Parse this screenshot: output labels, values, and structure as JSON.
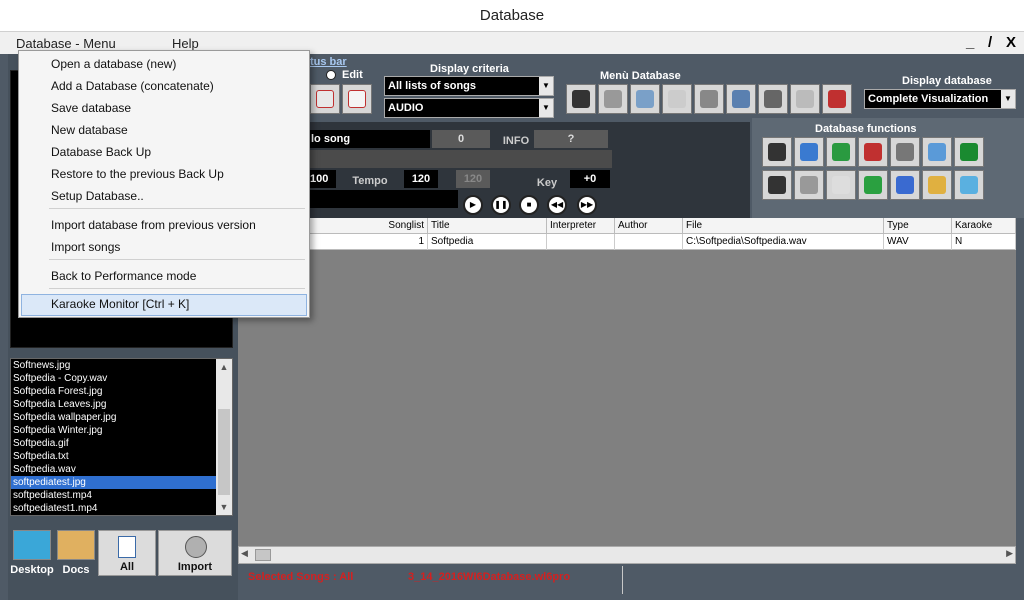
{
  "window": {
    "title": "Database"
  },
  "menubar": {
    "database_menu": "Database - Menu",
    "help": "Help",
    "min": "_",
    "restore": "/",
    "close": "X"
  },
  "popup_menu": {
    "items": [
      "Open a database (new)",
      "Add a Database (concatenate)",
      "Save database",
      "New database",
      "Database Back Up",
      "Restore to the previous Back Up",
      "Setup Database..",
      "Import database from previous version",
      "Import songs",
      "Back to Performance mode",
      "Karaoke Monitor [Ctrl + K]"
    ]
  },
  "toolbar": {
    "status_bar_label": "tus bar",
    "edit_label": "Edit",
    "display_criteria_label": "Display criteria",
    "criteria_value": "All lists of songs",
    "type_value": "AUDIO",
    "menu_database_label": "Menù Database",
    "display_database_label": "Display database",
    "display_database_value": "Complete Visualization",
    "database_functions_label": "Database functions"
  },
  "player": {
    "song_label": "lo song",
    "song_count": "0",
    "info_label": "INFO",
    "info_value": "?",
    "value_100": "100",
    "tempo_label": "Tempo",
    "tempo_value": "120",
    "tempo_ref": "120",
    "key_label": "Key",
    "key_value": "+0"
  },
  "file_list": {
    "items": [
      "Softnews.jpg",
      "Softpedia - Copy.wav",
      "Softpedia Forest.jpg",
      "Softpedia Leaves.jpg",
      "Softpedia wallpaper.jpg",
      "Softpedia Winter.jpg",
      "Softpedia.gif",
      "Softpedia.txt",
      "Softpedia.wav",
      "softpediatest.jpg",
      "softpediatest.mp4",
      "softpediatest1.mp4"
    ],
    "selected_index": 9
  },
  "bottom_buttons": {
    "desktop": "Desktop",
    "docs": "Docs",
    "all": "All",
    "import": "Import"
  },
  "table": {
    "headers": [
      "Songlist",
      "Title",
      "Interpreter",
      "Author",
      "File",
      "Type",
      "Karaoke"
    ],
    "rows": [
      {
        "songlist": "1",
        "title": "Softpedia",
        "interpreter": "",
        "author": "",
        "file": "C:\\Softpedia\\Softpedia.wav",
        "type": "WAV",
        "karaoke": "N"
      }
    ]
  },
  "status": {
    "selected_songs": "Selected Songs : All",
    "db_file": "3_14_2016WI6Database.wl6pro"
  },
  "colors": {
    "accent_blue": "#2f6fd0",
    "panel": "#4f5a66",
    "status_red": "#d42020"
  }
}
